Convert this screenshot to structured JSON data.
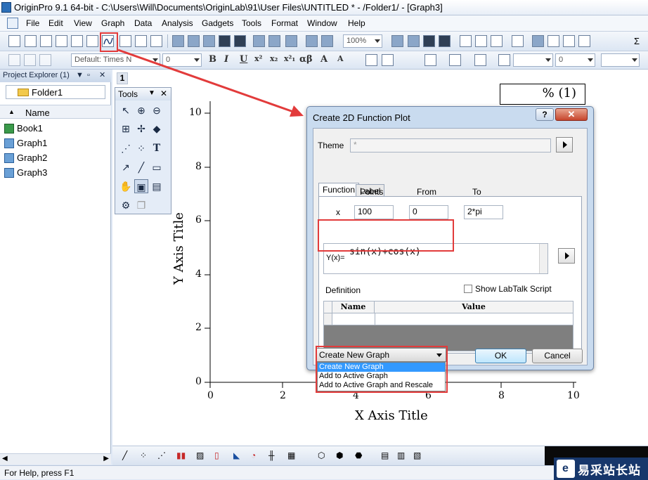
{
  "window": {
    "title": "OriginPro 9.1 64-bit - C:\\Users\\Will\\Documents\\OriginLab\\91\\User Files\\UNTITLED * - /Folder1/ - [Graph3]"
  },
  "menu": [
    "File",
    "Edit",
    "View",
    "Graph",
    "Data",
    "Analysis",
    "Gadgets",
    "Tools",
    "Format",
    "Window",
    "Help"
  ],
  "toolbar": {
    "zoom": "100%",
    "font": "Default: Times N",
    "font_size": "0",
    "format_glyphs": [
      "B",
      "I",
      "U",
      "x²",
      "x₂",
      "x²₁",
      "αβ",
      "A",
      "A"
    ],
    "line_width": "0"
  },
  "project_explorer": {
    "title": "Project Explorer (1)",
    "folder": "Folder1",
    "column": "Name",
    "items": [
      "Book1",
      "Graph1",
      "Graph2",
      "Graph3"
    ]
  },
  "graph": {
    "tab": "1",
    "legend": "% (1)",
    "x_title": "X Axis Title",
    "y_title": "Y Axis Title",
    "x_ticks": [
      "0",
      "2",
      "4",
      "6",
      "8",
      "10"
    ],
    "y_ticks": [
      "0",
      "2",
      "4",
      "6",
      "8",
      "10"
    ]
  },
  "tools": {
    "title": "Tools",
    "text_tool": "T"
  },
  "dialog": {
    "title": "Create 2D Function Plot",
    "help": "?",
    "close": "✕",
    "theme_label": "Theme",
    "theme_value": "*",
    "tabs": [
      "Function",
      "Label"
    ],
    "col_points": "Points",
    "col_from": "From",
    "col_to": "To",
    "x_label": "x",
    "points": "100",
    "from": "0",
    "to": "2*pi",
    "y_label": "Y(x)=",
    "expression": "sin(x)+cos(x)",
    "definition_label": "Definition",
    "show_labtalk": "Show LabTalk Script",
    "grid_headers": [
      "Name",
      "Value"
    ],
    "dropdown_value": "Create New Graph",
    "dropdown_options": [
      "Create New Graph",
      "Add to Active Graph",
      "Add to Active Graph and Rescale"
    ],
    "ok": "OK",
    "cancel": "Cancel"
  },
  "status": {
    "text": "For Help, press F1",
    "watermark": "易采站长站",
    "watermark_logo": "e"
  },
  "colors": {
    "annotation": "#e23b3b",
    "selection": "#3399ff"
  }
}
